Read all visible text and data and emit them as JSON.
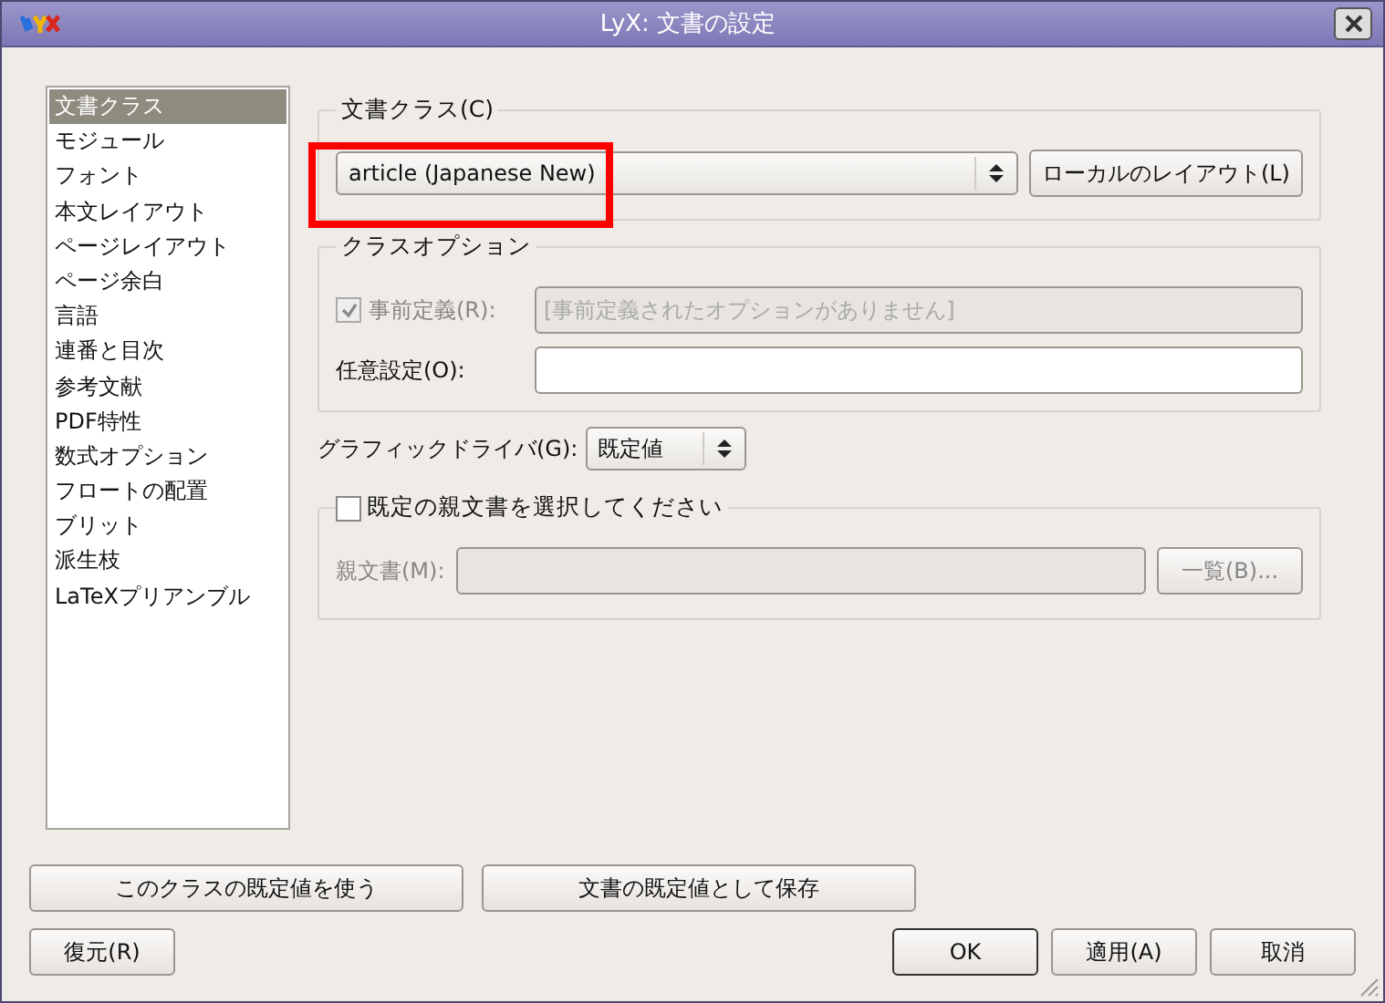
{
  "window": {
    "title": "LyX: 文書の設定"
  },
  "sidebar": {
    "items": [
      {
        "label": "文書クラス",
        "selected": true
      },
      {
        "label": "モジュール",
        "selected": false
      },
      {
        "label": "フォント",
        "selected": false
      },
      {
        "label": "本文レイアウト",
        "selected": false
      },
      {
        "label": "ページレイアウト",
        "selected": false
      },
      {
        "label": "ページ余白",
        "selected": false
      },
      {
        "label": "言語",
        "selected": false
      },
      {
        "label": "連番と目次",
        "selected": false
      },
      {
        "label": "参考文献",
        "selected": false
      },
      {
        "label": "PDF特性",
        "selected": false
      },
      {
        "label": "数式オプション",
        "selected": false
      },
      {
        "label": "フロートの配置",
        "selected": false
      },
      {
        "label": "ブリット",
        "selected": false
      },
      {
        "label": "派生枝",
        "selected": false
      },
      {
        "label": "LaTeXプリアンブル",
        "selected": false
      }
    ]
  },
  "class_group": {
    "label": "文書クラス(C)",
    "combo": {
      "value": "article (Japanese New)"
    },
    "button": "ローカルのレイアウト(L)",
    "highlight": {
      "kind": "rectangle"
    }
  },
  "options_group": {
    "label": "クラスオプション",
    "predefined": {
      "label": "事前定義(R):",
      "checked": true,
      "disabled": true,
      "value": "[事前定義されたオプションがありません]"
    },
    "custom": {
      "label": "任意設定(O):"
    }
  },
  "graphics": {
    "label": "グラフィックドライバ(G):",
    "value": "既定値"
  },
  "master_group": {
    "label": "既定の親文書を選択してください",
    "checked": false,
    "disabled": true,
    "field_label": "親文書(M):",
    "button": "一覧(B)..."
  },
  "buttons_top": [
    {
      "label": "このクラスの既定値を使う"
    },
    {
      "label": "文書の既定値として保存"
    }
  ],
  "buttons_bottom": [
    {
      "label": "復元(R)",
      "kind": "left",
      "default": false
    },
    {
      "label": "OK",
      "kind": "right",
      "default": true
    },
    {
      "label": "適用(A)",
      "kind": "right",
      "default": false
    },
    {
      "label": "取消",
      "kind": "right",
      "default": false
    }
  ]
}
